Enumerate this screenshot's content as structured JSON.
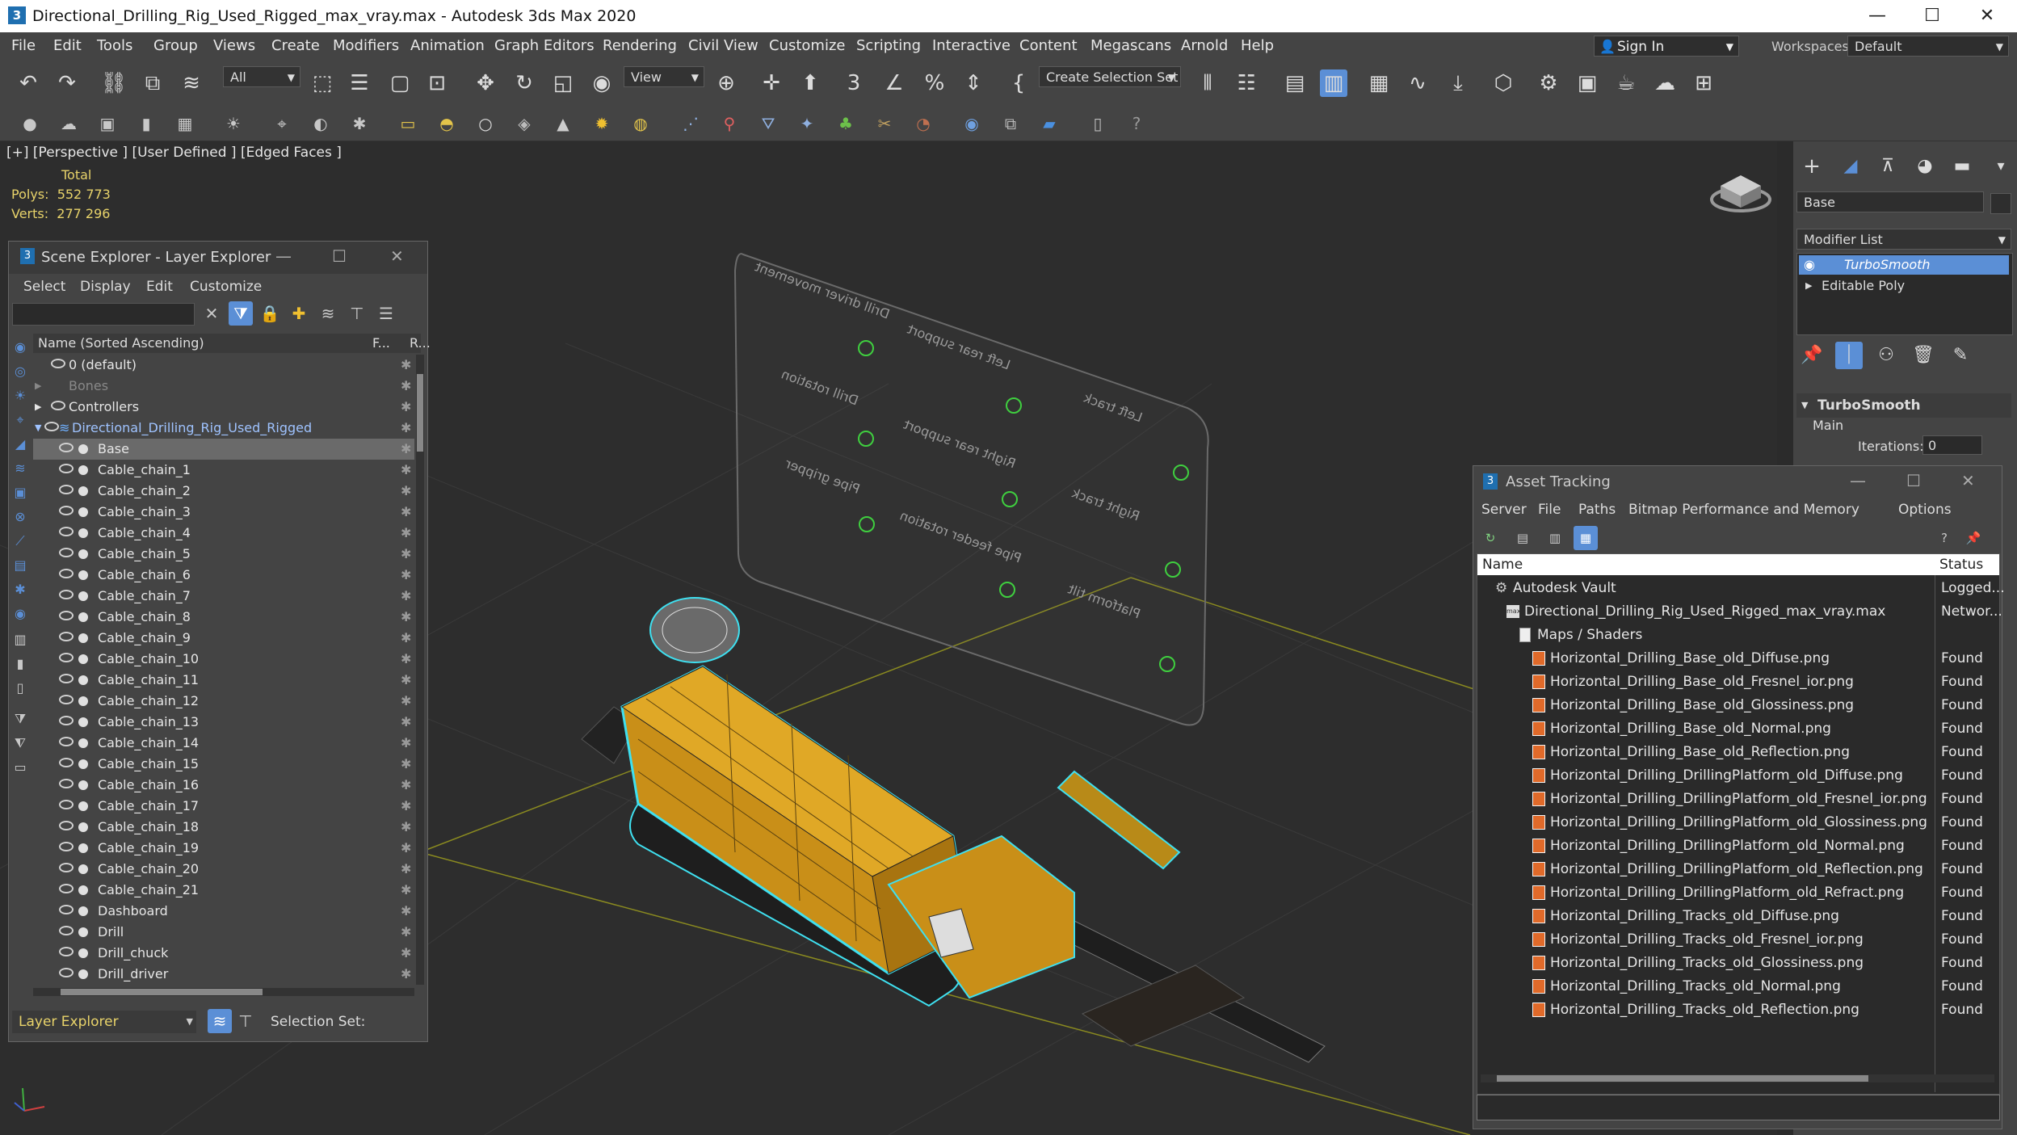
{
  "window": {
    "title": "Directional_Drilling_Rig_Used_Rigged_max_vray.max - Autodesk 3ds Max 2020",
    "app_icon": "3",
    "minimize": "—",
    "maximize": "☐",
    "close": "✕"
  },
  "menu": [
    "File",
    "Edit",
    "Tools",
    "Group",
    "Views",
    "Create",
    "Modifiers",
    "Animation",
    "Graph Editors",
    "Rendering",
    "Civil View",
    "Customize",
    "Scripting",
    "Interactive",
    "Content",
    "Megascans",
    "Arnold",
    "Help"
  ],
  "signin": {
    "label": "Sign In"
  },
  "workspaces": {
    "label": "Workspaces:",
    "value": "Default"
  },
  "toolbar": {
    "selection_filter": "All",
    "ref_coord": "View",
    "create_selection_set": "Create Selection Set"
  },
  "viewport": {
    "label": "[+] [Perspective ] [User Defined ] [Edged Faces ]",
    "stats_header": "Total",
    "polys_label": "Polys:",
    "polys_value": "552 773",
    "verts_label": "Verts:",
    "verts_value": "277 296",
    "control_panel_labels": [
      "Drill driver movement",
      "Left rear support",
      "Left track",
      "Drill rotation",
      "Right rear support",
      "Right track",
      "Pipe gripper",
      "Pipe feeder rotation",
      "Platform tilt"
    ]
  },
  "command_panel": {
    "object_name": "Base",
    "modifier_list": "Modifier List",
    "modifiers": [
      "TurboSmooth",
      "Editable Poly"
    ],
    "rollout_title": "TurboSmooth",
    "section_main": "Main",
    "iterations_label": "Iterations:",
    "iterations_value": "0"
  },
  "scene_explorer": {
    "title": "Scene Explorer - Layer Explorer",
    "menu": [
      "Select",
      "Display",
      "Edit",
      "Customize"
    ],
    "col_name": "Name (Sorted Ascending)",
    "col_f": "F...",
    "col_r": "R...",
    "rows": [
      {
        "name": "0 (default)",
        "level": 0
      },
      {
        "name": "Bones",
        "level": 0
      },
      {
        "name": "Controllers",
        "level": 0
      },
      {
        "name": "Directional_Drilling_Rig_Used_Rigged",
        "level": 0
      },
      {
        "name": "Base",
        "level": 1
      },
      {
        "name": "Cable_chain_1",
        "level": 1
      },
      {
        "name": "Cable_chain_2",
        "level": 1
      },
      {
        "name": "Cable_chain_3",
        "level": 1
      },
      {
        "name": "Cable_chain_4",
        "level": 1
      },
      {
        "name": "Cable_chain_5",
        "level": 1
      },
      {
        "name": "Cable_chain_6",
        "level": 1
      },
      {
        "name": "Cable_chain_7",
        "level": 1
      },
      {
        "name": "Cable_chain_8",
        "level": 1
      },
      {
        "name": "Cable_chain_9",
        "level": 1
      },
      {
        "name": "Cable_chain_10",
        "level": 1
      },
      {
        "name": "Cable_chain_11",
        "level": 1
      },
      {
        "name": "Cable_chain_12",
        "level": 1
      },
      {
        "name": "Cable_chain_13",
        "level": 1
      },
      {
        "name": "Cable_chain_14",
        "level": 1
      },
      {
        "name": "Cable_chain_15",
        "level": 1
      },
      {
        "name": "Cable_chain_16",
        "level": 1
      },
      {
        "name": "Cable_chain_17",
        "level": 1
      },
      {
        "name": "Cable_chain_18",
        "level": 1
      },
      {
        "name": "Cable_chain_19",
        "level": 1
      },
      {
        "name": "Cable_chain_20",
        "level": 1
      },
      {
        "name": "Cable_chain_21",
        "level": 1
      },
      {
        "name": "Dashboard",
        "level": 1
      },
      {
        "name": "Drill",
        "level": 1
      },
      {
        "name": "Drill_chuck",
        "level": 1
      },
      {
        "name": "Drill_driver",
        "level": 1
      }
    ],
    "footer_explorer": "Layer Explorer",
    "footer_selection_set": "Selection Set:"
  },
  "asset_tracking": {
    "title": "Asset Tracking",
    "menu": [
      "Server",
      "File",
      "Paths",
      "Bitmap Performance and Memory",
      "Options"
    ],
    "col_name": "Name",
    "col_status": "Status",
    "rows": [
      {
        "name": "Autodesk Vault",
        "status": "Logged...",
        "level": 0,
        "icon": "vault"
      },
      {
        "name": "Directional_Drilling_Rig_Used_Rigged_max_vray.max",
        "status": "Networ...",
        "level": 1,
        "icon": "max"
      },
      {
        "name": "Maps / Shaders",
        "status": "",
        "level": 2,
        "icon": "folder"
      },
      {
        "name": "Horizontal_Drilling_Base_old_Diffuse.png",
        "status": "Found",
        "level": 3,
        "icon": "file"
      },
      {
        "name": "Horizontal_Drilling_Base_old_Fresnel_ior.png",
        "status": "Found",
        "level": 3,
        "icon": "file"
      },
      {
        "name": "Horizontal_Drilling_Base_old_Glossiness.png",
        "status": "Found",
        "level": 3,
        "icon": "file"
      },
      {
        "name": "Horizontal_Drilling_Base_old_Normal.png",
        "status": "Found",
        "level": 3,
        "icon": "file"
      },
      {
        "name": "Horizontal_Drilling_Base_old_Reflection.png",
        "status": "Found",
        "level": 3,
        "icon": "file"
      },
      {
        "name": "Horizontal_Drilling_DrillingPlatform_old_Diffuse.png",
        "status": "Found",
        "level": 3,
        "icon": "file"
      },
      {
        "name": "Horizontal_Drilling_DrillingPlatform_old_Fresnel_ior.png",
        "status": "Found",
        "level": 3,
        "icon": "file"
      },
      {
        "name": "Horizontal_Drilling_DrillingPlatform_old_Glossiness.png",
        "status": "Found",
        "level": 3,
        "icon": "file"
      },
      {
        "name": "Horizontal_Drilling_DrillingPlatform_old_Normal.png",
        "status": "Found",
        "level": 3,
        "icon": "file"
      },
      {
        "name": "Horizontal_Drilling_DrillingPlatform_old_Reflection.png",
        "status": "Found",
        "level": 3,
        "icon": "file"
      },
      {
        "name": "Horizontal_Drilling_DrillingPlatform_old_Refract.png",
        "status": "Found",
        "level": 3,
        "icon": "file"
      },
      {
        "name": "Horizontal_Drilling_Tracks_old_Diffuse.png",
        "status": "Found",
        "level": 3,
        "icon": "file"
      },
      {
        "name": "Horizontal_Drilling_Tracks_old_Fresnel_ior.png",
        "status": "Found",
        "level": 3,
        "icon": "file"
      },
      {
        "name": "Horizontal_Drilling_Tracks_old_Glossiness.png",
        "status": "Found",
        "level": 3,
        "icon": "file"
      },
      {
        "name": "Horizontal_Drilling_Tracks_old_Normal.png",
        "status": "Found",
        "level": 3,
        "icon": "file"
      },
      {
        "name": "Horizontal_Drilling_Tracks_old_Reflection.png",
        "status": "Found",
        "level": 3,
        "icon": "file"
      }
    ]
  },
  "colors": {
    "accent_blue": "#5b8fd6",
    "selection_cyan": "#3fe0f0",
    "rig_yellow": "#d9a21a",
    "stat_yellow": "#e8d36a"
  }
}
